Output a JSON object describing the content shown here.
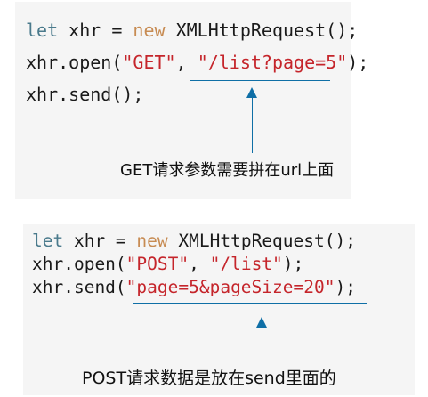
{
  "get_example": {
    "line1": {
      "kw1": "let",
      "ident": " xhr = ",
      "kw2": "new",
      "rest": " XMLHttpRequest();"
    },
    "line2": {
      "pre": "xhr.open(",
      "method": "\"GET\"",
      "sep": ", ",
      "url": "\"/list?page=5\"",
      "post": ");"
    },
    "line3": "xhr.send();",
    "annotation": "GET请求参数需要拼在url上面"
  },
  "post_example": {
    "line1": {
      "kw1": "let",
      "ident": " xhr = ",
      "kw2": "new",
      "rest": " XMLHttpRequest();"
    },
    "line2": {
      "pre": "xhr.open(",
      "method": "\"POST\"",
      "sep": ", ",
      "url": "\"/list\"",
      "post": ");"
    },
    "line3": {
      "pre": "xhr.send(",
      "body": "\"page=5&pageSize=20\"",
      "post": ");"
    },
    "annotation": "POST请求数据是放在send里面的"
  },
  "colors": {
    "keyword_let": "#4a7a8c",
    "keyword_new": "#c78b52",
    "string": "#c5252b",
    "arrow": "#0f6fa6",
    "panel_bg": "#f5f5f5"
  }
}
